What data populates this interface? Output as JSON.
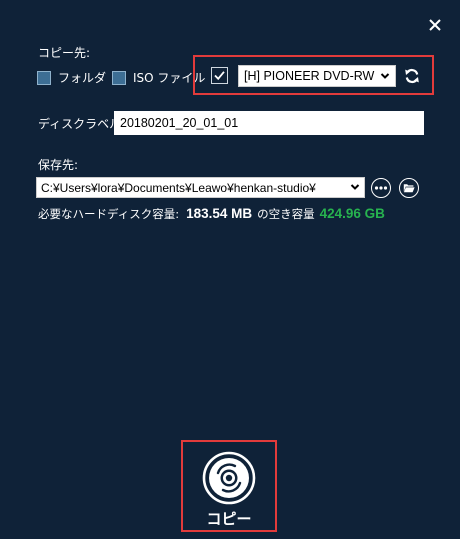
{
  "copy_destination": {
    "label": "コピー先:",
    "folder_option": "フォルダ",
    "iso_option": "ISO ファイル",
    "disc_checked": true,
    "drive_selected": "[H] PIONEER DVD-RW"
  },
  "disc_label": {
    "label": "ディスクラベル:",
    "value": "20180201_20_01_01"
  },
  "save_location": {
    "label": "保存先:",
    "path": "C:¥Users¥lora¥Documents¥Leawo¥henkan-studio¥"
  },
  "disk_space": {
    "required_label": "必要なハードディスク容量:",
    "required_value": "183.54 MB",
    "free_label": "の空き容量",
    "free_value": "424.96 GB"
  },
  "copy_button": {
    "label": "コピー"
  },
  "colors": {
    "background": "#0f2238",
    "highlight": "#e23b3b",
    "free_space_green": "#27b34f",
    "checkbox_fill": "#3d6e94"
  },
  "icons": {
    "close": "close-icon",
    "refresh": "refresh-icon",
    "more": "more-icon",
    "folder": "folder-open-icon",
    "copy": "disc-icon"
  }
}
